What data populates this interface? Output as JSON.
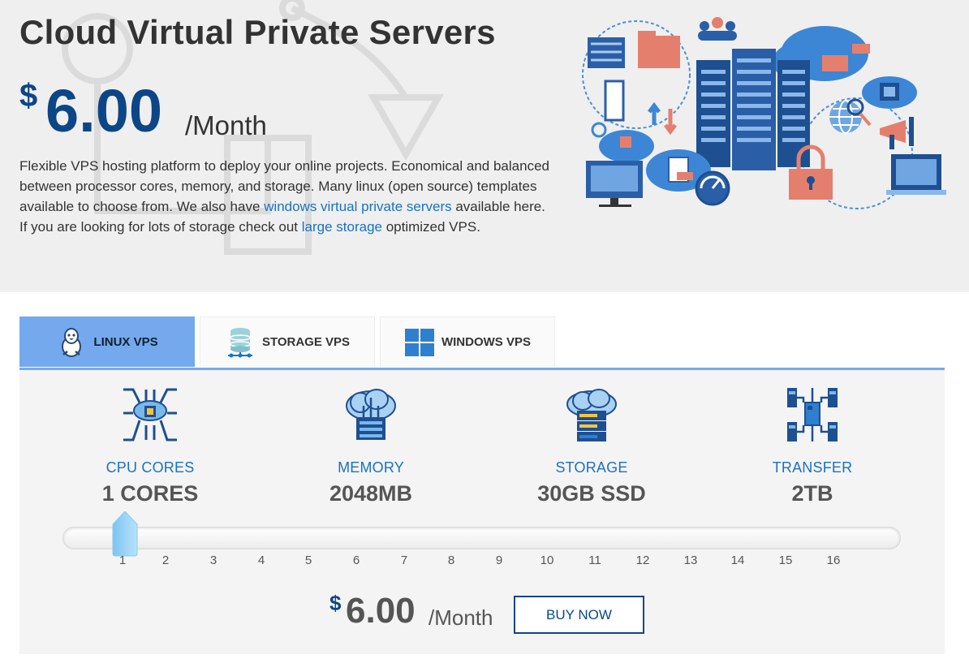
{
  "hero": {
    "title": "Cloud Virtual Private Servers",
    "price": {
      "currency": "$",
      "amount": "6.00",
      "period": "/Month"
    },
    "desc_1": "Flexible VPS hosting platform to deploy your online projects. Economical and balanced between processor cores, memory, and storage. Many linux (open source) templates available to choose from. We also have ",
    "link_windows": "windows virtual private servers",
    "desc_2": " available here. If you are looking for lots of storage check out ",
    "link_storage": "large storage",
    "desc_3": " optimized VPS."
  },
  "tabs": [
    {
      "label": "LINUX VPS",
      "icon": "linux-penguin-icon",
      "active": true
    },
    {
      "label": "STORAGE VPS",
      "icon": "database-icon",
      "active": false
    },
    {
      "label": "WINDOWS VPS",
      "icon": "windows-logo-icon",
      "active": false
    }
  ],
  "features": [
    {
      "label": "CPU CORES",
      "value": "1 CORES",
      "icon": "cpu-chip-icon"
    },
    {
      "label": "MEMORY",
      "value": "2048MB",
      "icon": "cloud-memory-icon"
    },
    {
      "label": "STORAGE",
      "value": "30GB SSD",
      "icon": "cloud-storage-icon"
    },
    {
      "label": "TRANSFER",
      "value": "2TB",
      "icon": "transfer-network-icon"
    }
  ],
  "slider": {
    "selected": 1,
    "ticks": [
      "1",
      "2",
      "3",
      "4",
      "5",
      "6",
      "7",
      "8",
      "9",
      "10",
      "11",
      "12",
      "13",
      "14",
      "15",
      "16"
    ]
  },
  "plan_price": {
    "currency": "$",
    "amount": "6.00",
    "period": "/Month"
  },
  "buy_button": "BUY NOW",
  "colors": {
    "brand_dark": "#0c4687",
    "link": "#1a72c2",
    "tab_active": "#74a9ee"
  }
}
